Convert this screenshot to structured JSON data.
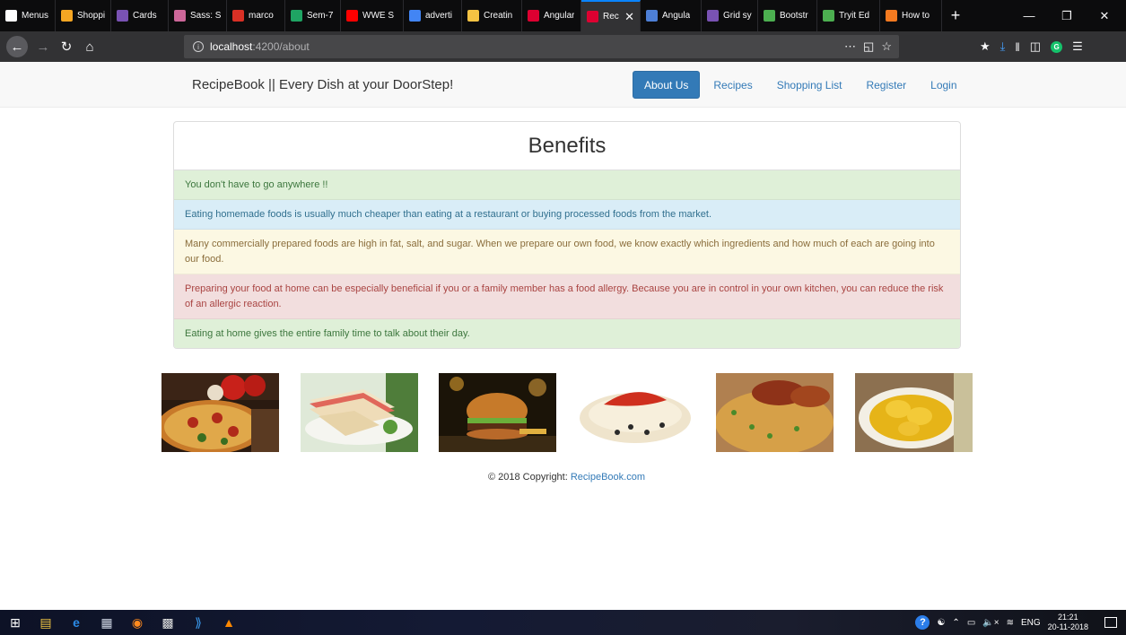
{
  "browser": {
    "tabs": [
      {
        "label": "Menus",
        "icon": "menu-icon",
        "color": "#ffffff"
      },
      {
        "label": "Shoppi",
        "icon": "bag-icon",
        "color": "#f5a623"
      },
      {
        "label": "Cards",
        "icon": "bootstrap-icon",
        "color": "#7952b3"
      },
      {
        "label": "Sass: Sy",
        "icon": "sass-icon",
        "color": "#cd6799"
      },
      {
        "label": "marco",
        "icon": "gmail-icon",
        "color": "#d93025"
      },
      {
        "label": "Sem-7",
        "icon": "drive-icon",
        "color": "#1fa463"
      },
      {
        "label": "WWE S",
        "icon": "youtube-icon",
        "color": "#ff0000"
      },
      {
        "label": "adverti",
        "icon": "google-icon",
        "color": "#4285f4"
      },
      {
        "label": "Creatin",
        "icon": "creating-icon",
        "color": "#f6c343"
      },
      {
        "label": "Angular",
        "icon": "angular-icon",
        "color": "#dd0031"
      },
      {
        "label": "Reci",
        "icon": "angular-icon",
        "color": "#dd0031"
      },
      {
        "label": "Angula",
        "icon": "mdn-icon",
        "color": "#4d7fd6"
      },
      {
        "label": "Grid sy",
        "icon": "bootstrap-icon",
        "color": "#7952b3"
      },
      {
        "label": "Bootstr",
        "icon": "w3schools-icon",
        "color": "#4caf50"
      },
      {
        "label": "Tryit Ed",
        "icon": "w3schools-icon",
        "color": "#4caf50"
      },
      {
        "label": "How to",
        "icon": "howto-icon",
        "color": "#f47a20"
      }
    ],
    "active_tab_index": 10,
    "url_host": "localhost",
    "url_rest": ":4200/about",
    "accent": "#0a84ff"
  },
  "site": {
    "brand": "RecipeBook || Every Dish at your DoorStep!",
    "nav": [
      {
        "label": "About Us",
        "active": true
      },
      {
        "label": "Recipes",
        "active": false
      },
      {
        "label": "Shopping List",
        "active": false
      },
      {
        "label": "Register",
        "active": false
      },
      {
        "label": "Login",
        "active": false
      }
    ],
    "primary_color": "#337ab7"
  },
  "benefits": {
    "title": "Benefits",
    "items": [
      {
        "text": "You don't have to go anywhere !!",
        "variant": "success"
      },
      {
        "text": "Eating homemade foods is usually much cheaper than eating at a restaurant or buying processed foods from the market.",
        "variant": "info"
      },
      {
        "text": "Many commercially prepared foods are high in fat, salt, and sugar. When we prepare our own food, we know exactly which ingredients and how much of each are going into our food.",
        "variant": "warning"
      },
      {
        "text": "Preparing your food at home can be especially beneficial if you or a family member has a food allergy. Because you are in control in your own kitchen, you can reduce the risk of an allergic reaction.",
        "variant": "danger"
      },
      {
        "text": "Eating at home gives the entire family time to talk about their day.",
        "variant": "success"
      }
    ]
  },
  "gallery": [
    {
      "name": "pizza-image"
    },
    {
      "name": "sandwich-image"
    },
    {
      "name": "burger-image"
    },
    {
      "name": "taco-image"
    },
    {
      "name": "biryani-image"
    },
    {
      "name": "dumplings-image"
    }
  ],
  "footer": {
    "copyright": "© 2018 Copyright:",
    "link": "RecipeBook.com"
  },
  "taskbar": {
    "language": "ENG",
    "time": "21:21",
    "date": "20-11-2018"
  }
}
